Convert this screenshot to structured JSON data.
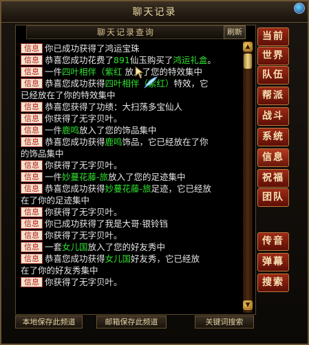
{
  "window": {
    "title": "聊天记录"
  },
  "header": {
    "search_title": "聊天记录查询",
    "refresh_label": "刷新"
  },
  "tag_label": "信息",
  "messages": [
    {
      "parts": [
        {
          "t": "你已成功获得了鸿运宝珠"
        }
      ]
    },
    {
      "parts": [
        {
          "t": "恭喜您成功花费了"
        },
        {
          "t": "891",
          "c": "g"
        },
        {
          "t": "仙玉购买了"
        },
        {
          "t": "鸿运礼盒",
          "c": "g"
        },
        {
          "t": "。"
        }
      ]
    },
    {
      "parts": [
        {
          "t": "一件"
        },
        {
          "t": "四叶相伴（紫红",
          "c": "g"
        },
        {
          "t": "  放入了您的特效集中"
        }
      ]
    },
    {
      "parts": [
        {
          "t": "恭喜您成功获得"
        },
        {
          "t": "四叶相伴（紫红）",
          "c": "g"
        },
        {
          "t": "特效，它"
        }
      ]
    },
    {
      "cont": true,
      "parts": [
        {
          "t": "已经放在了你的特效集中"
        }
      ]
    },
    {
      "parts": [
        {
          "t": "恭喜您获得了功绩：大扫荡多宝仙人"
        }
      ]
    },
    {
      "parts": [
        {
          "t": "你获得了无字贝叶。"
        }
      ]
    },
    {
      "parts": [
        {
          "t": "一件"
        },
        {
          "t": "鹿鸣",
          "c": "g"
        },
        {
          "t": "放入了您的饰品集中"
        }
      ]
    },
    {
      "parts": [
        {
          "t": "恭喜您成功获得"
        },
        {
          "t": "鹿鸣",
          "c": "g"
        },
        {
          "t": "饰品，它已经放在了你"
        }
      ]
    },
    {
      "cont": true,
      "parts": [
        {
          "t": "的饰品集中"
        }
      ]
    },
    {
      "parts": [
        {
          "t": "你获得了无字贝叶。"
        }
      ]
    },
    {
      "parts": [
        {
          "t": "一件"
        },
        {
          "t": "妙蔓花藤-旅",
          "c": "g"
        },
        {
          "t": "放入了您的足迹集中"
        }
      ]
    },
    {
      "parts": [
        {
          "t": "恭喜您成功获得"
        },
        {
          "t": "妙蔓花藤-旅",
          "c": "g"
        },
        {
          "t": "足迹，它已经放"
        }
      ]
    },
    {
      "cont": true,
      "parts": [
        {
          "t": "在了你的足迹集中"
        }
      ]
    },
    {
      "parts": [
        {
          "t": "你获得了无字贝叶。"
        }
      ]
    },
    {
      "parts": [
        {
          "t": "你已成功获得了我是大哥·银铃铛"
        }
      ]
    },
    {
      "parts": [
        {
          "t": "你获得了无字贝叶。"
        }
      ]
    },
    {
      "parts": [
        {
          "t": "一套"
        },
        {
          "t": "女儿国",
          "c": "g"
        },
        {
          "t": "放入了您的好友秀中"
        }
      ]
    },
    {
      "parts": [
        {
          "t": "恭喜您成功获得"
        },
        {
          "t": "女儿国",
          "c": "g"
        },
        {
          "t": "好友秀，它已经放"
        }
      ]
    },
    {
      "cont": true,
      "parts": [
        {
          "t": "在了你的好友秀集中"
        }
      ]
    },
    {
      "parts": [
        {
          "t": "你获得了无字贝叶。"
        }
      ]
    }
  ],
  "tabs": [
    {
      "label": "当前"
    },
    {
      "label": "世界"
    },
    {
      "label": "队伍"
    },
    {
      "label": "帮派"
    },
    {
      "label": "战斗"
    },
    {
      "label": "系统"
    },
    {
      "label": "信息"
    },
    {
      "label": "祝福"
    },
    {
      "label": "团队"
    },
    {
      "label": "传音"
    },
    {
      "label": "弹幕"
    },
    {
      "label": "搜索"
    }
  ],
  "footer": {
    "local_save": "本地保存此频道",
    "mail_save": "邮箱保存此频道",
    "keyword_search": "关键词搜索"
  },
  "colors": {
    "highlight": "#2fe22f",
    "tag_text": "#c01818"
  }
}
